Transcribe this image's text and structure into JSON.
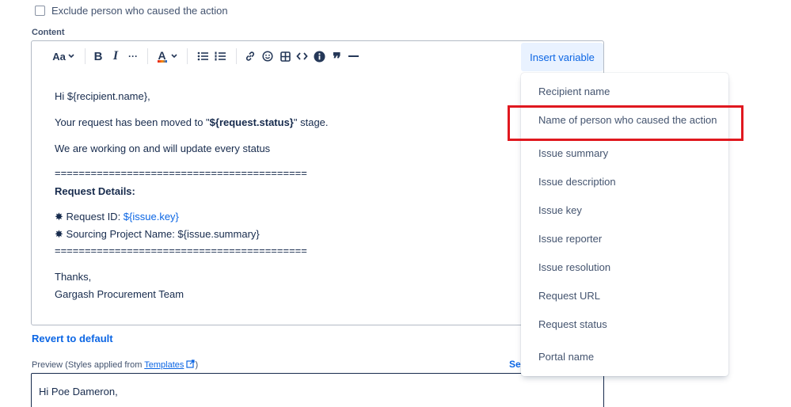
{
  "exclude_checkbox": {
    "label": "Exclude person who caused the action",
    "checked": false
  },
  "content_label": "Content",
  "toolbar": {
    "text_style": "Aa",
    "bold": "B",
    "italic": "I",
    "more": "···",
    "text_color": "A",
    "quote": "99",
    "insert_variable": "Insert variable",
    "icons": [
      "text-style-icon",
      "bold-icon",
      "italic-icon",
      "more-formatting-icon",
      "text-color-icon",
      "bullet-list-icon",
      "numbered-list-icon",
      "link-icon",
      "emoji-icon",
      "table-icon",
      "code-icon",
      "info-icon",
      "quote-icon",
      "divider-icon"
    ]
  },
  "editor": {
    "greeting": "Hi ${recipient.name},",
    "line2_prefix": "Your request has been moved to \"",
    "line2_var": "${request.status}",
    "line2_suffix": "\" stage.",
    "line3": "We are working on and will update every status",
    "divider": "==========================================",
    "details_heading": "Request Details:",
    "bullet": "✸",
    "request_id_label": "Request ID: ",
    "request_id_var": "${issue.key}",
    "project_name": "Sourcing Project Name: ${issue.summary}",
    "thanks": "Thanks,",
    "signature": "Gargash Procurement Team"
  },
  "revert_link": "Revert to default",
  "preview": {
    "label_prefix": "Preview (Styles applied from ",
    "templates_link": "Templates",
    "label_suffix": ")",
    "right_link": "Se",
    "greeting": "Hi Poe Dameron,"
  },
  "insert_variable_menu": [
    "Recipient name",
    "Name of person who caused the action",
    "Issue summary",
    "Issue description",
    "Issue key",
    "Issue reporter",
    "Issue resolution",
    "Request URL",
    "Request status",
    "Portal name"
  ],
  "colors": {
    "accent": "#0c66e4",
    "highlight": "#e0181f",
    "insert_bg": "#e9f2ff",
    "text": "#172b4d"
  }
}
